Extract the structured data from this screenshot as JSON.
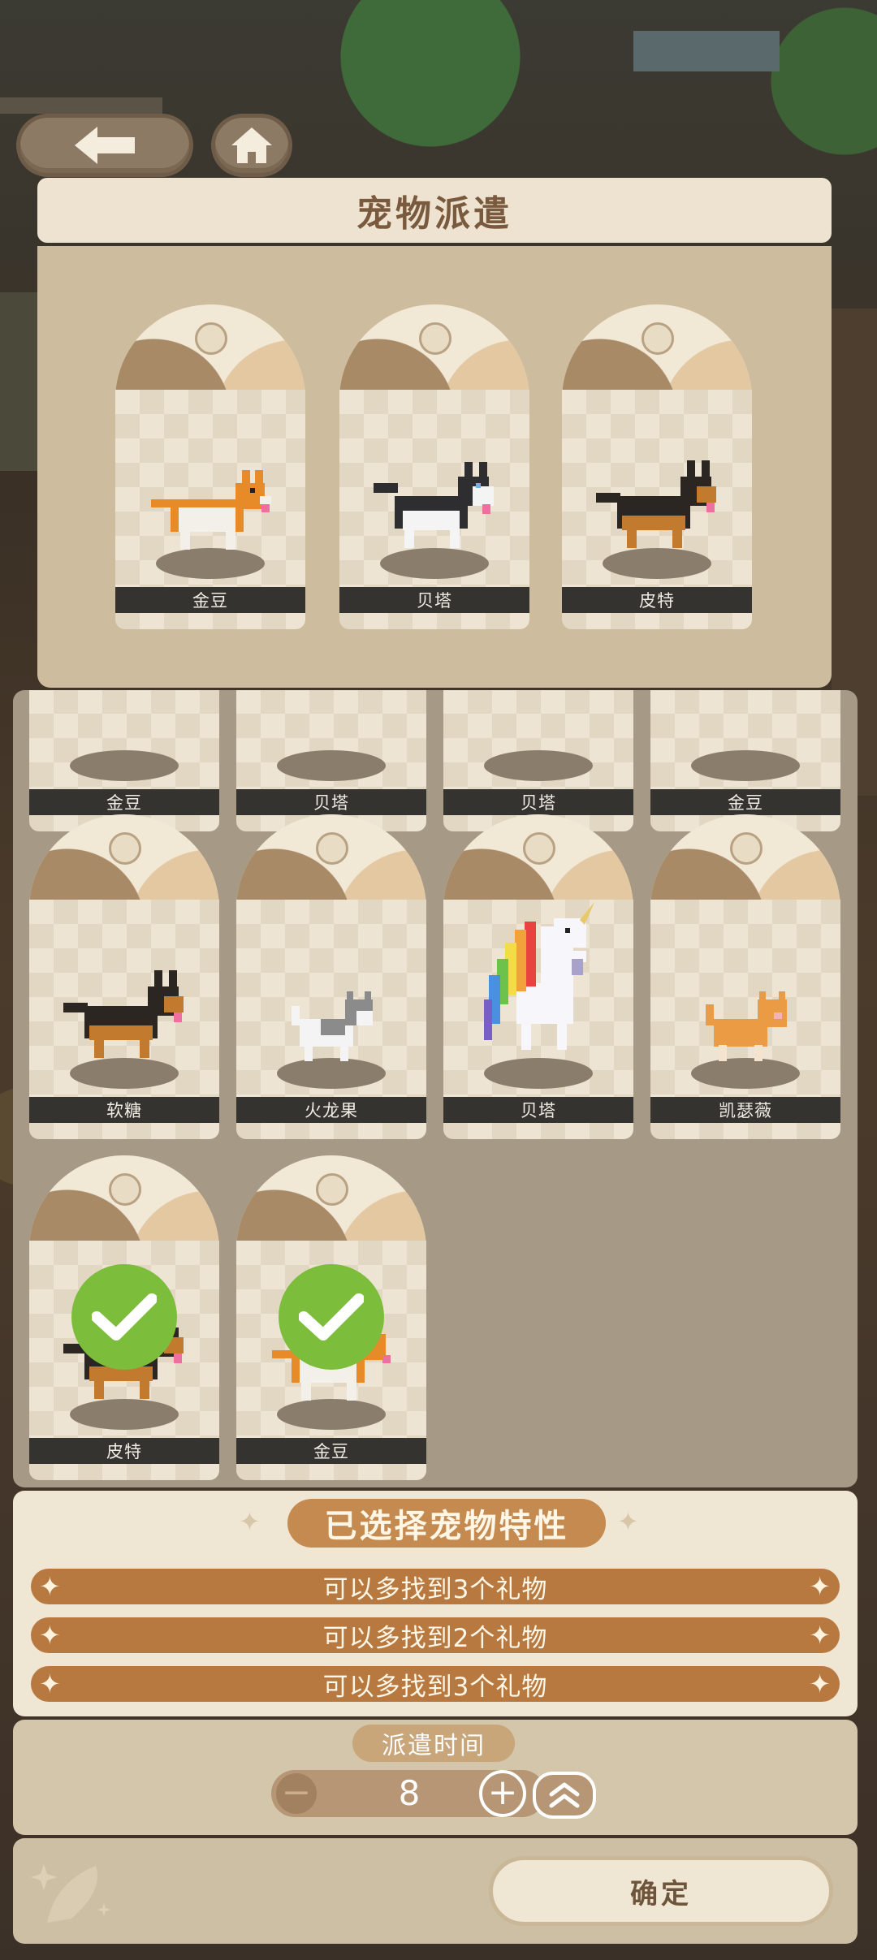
{
  "page_title": "宠物派遣",
  "selected_pets": [
    {
      "name": "金豆",
      "species": "corgi"
    },
    {
      "name": "贝塔",
      "species": "husky"
    },
    {
      "name": "皮特",
      "species": "shepherd"
    }
  ],
  "pet_grid": {
    "partial_row": [
      "金豆",
      "贝塔",
      "贝塔",
      "金豆"
    ],
    "rows": [
      [
        {
          "name": "软糖",
          "species": "shepherd",
          "selected": false
        },
        {
          "name": "火龙果",
          "species": "cat-white",
          "selected": false
        },
        {
          "name": "贝塔",
          "species": "unicorn",
          "selected": false
        },
        {
          "name": "凯瑟薇",
          "species": "cat-orange",
          "selected": false
        }
      ],
      [
        {
          "name": "皮特",
          "species": "shepherd",
          "selected": true
        },
        {
          "name": "金豆",
          "species": "corgi",
          "selected": true
        }
      ]
    ]
  },
  "traits": {
    "title": "已选择宠物特性",
    "items": [
      "可以多找到3个礼物",
      "可以多找到2个礼物",
      "可以多找到3个礼物"
    ]
  },
  "dispatch_time": {
    "label": "派遣时间",
    "value": "8",
    "minus_icon": "minus-icon",
    "plus_icon": "plus-icon",
    "max_icon": "double-chevron-up-icon"
  },
  "confirm_label": "确定",
  "icons": {
    "back": "back-arrow-icon",
    "home": "home-icon",
    "check": "check-icon",
    "feather": "feather-icon"
  },
  "colors": {
    "check_green": "#7cbd3c",
    "trait_orange": "#b87940",
    "title_brown": "#7a5a3e"
  }
}
